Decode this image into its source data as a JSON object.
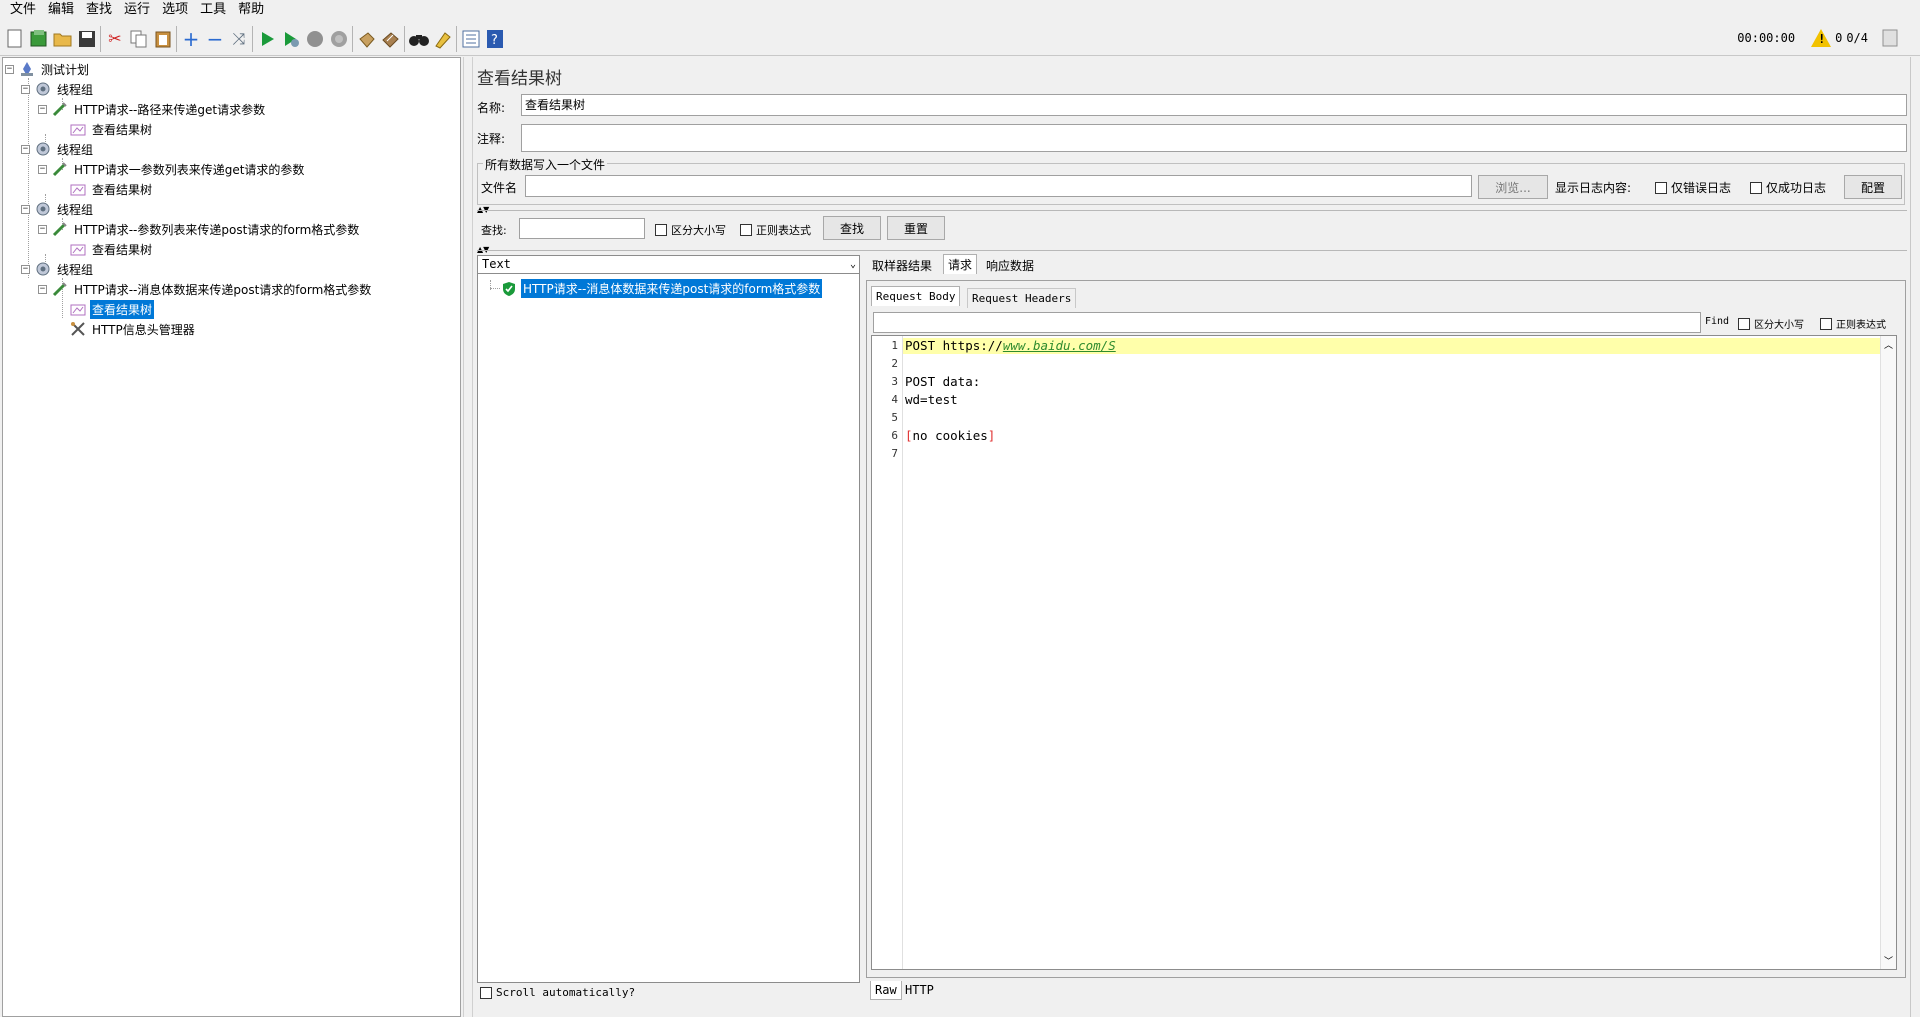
{
  "menu": [
    "文件",
    "编辑",
    "查找",
    "运行",
    "选项",
    "工具",
    "帮助"
  ],
  "toolbar": {
    "icons": [
      "new-icon",
      "templates-icon",
      "open-icon",
      "save-icon",
      "cut-icon",
      "copy-icon",
      "paste-icon",
      "expand-icon",
      "collapse-icon",
      "toggle-icon",
      "start-icon",
      "start-no-pause-icon",
      "stop-icon",
      "shutdown-icon",
      "clear-icon",
      "clear-all-icon",
      "search-icon",
      "reset-search-icon",
      "function-helper-icon",
      "help-icon"
    ],
    "timer": "00:00:00",
    "warning_count": "0",
    "threads": "0/4"
  },
  "tree": {
    "items": [
      {
        "label": "测试计划",
        "icon": "test-plan-icon",
        "level": 0
      },
      {
        "label": "线程组",
        "icon": "thread-group-icon",
        "level": 1
      },
      {
        "label": "HTTP请求--路径来传递get请求参数",
        "icon": "http-sampler-icon",
        "level": 2
      },
      {
        "label": "查看结果树",
        "icon": "listener-icon",
        "level": 3
      },
      {
        "label": "线程组",
        "icon": "thread-group-icon",
        "level": 1
      },
      {
        "label": "HTTP请求一参数列表来传递get请求的参数",
        "icon": "http-sampler-icon",
        "level": 2
      },
      {
        "label": "查看结果树",
        "icon": "listener-icon",
        "level": 3
      },
      {
        "label": "线程组",
        "icon": "thread-group-icon",
        "level": 1
      },
      {
        "label": "HTTP请求--参数列表来传递post请求的form格式参数",
        "icon": "http-sampler-icon",
        "level": 2
      },
      {
        "label": "查看结果树",
        "icon": "listener-icon",
        "level": 3
      },
      {
        "label": "线程组",
        "icon": "thread-group-icon",
        "level": 1
      },
      {
        "label": "HTTP请求--消息体数据来传递post请求的form格式参数",
        "icon": "http-sampler-icon",
        "level": 2
      },
      {
        "label": "查看结果树",
        "icon": "listener-icon",
        "level": 3,
        "selected": true
      },
      {
        "label": "HTTP信息头管理器",
        "icon": "header-manager-icon",
        "level": 3
      }
    ]
  },
  "panel": {
    "title": "查看结果树",
    "name_label": "名称:",
    "name_value": "查看结果树",
    "comment_label": "注释:",
    "comment_value": "",
    "file_group_title": "所有数据写入一个文件",
    "file_label": "文件名",
    "file_value": "",
    "browse_button": "浏览...",
    "log_content_label": "显示日志内容:",
    "errors_only": "仅错误日志",
    "success_only": "仅成功日志",
    "configure_button": "配置",
    "search_label": "查找:",
    "search_value": "",
    "case_sensitive": "区分大小写",
    "regex": "正则表达式",
    "find_button": "查找",
    "reset_button": "重置"
  },
  "results": {
    "renderer": "Text",
    "sample_label": "HTTP请求--消息体数据来传递post请求的form格式参数",
    "scroll_auto": "Scroll automatically?"
  },
  "detail": {
    "tabs": [
      "取样器结果",
      "请求",
      "响应数据"
    ],
    "active_tab": "请求",
    "subtabs": [
      "Request Body",
      "Request Headers"
    ],
    "find_label": "Find",
    "find_case": "区分大小写",
    "find_regex": "正则表达式",
    "lines": [
      "1",
      "2",
      "3",
      "4",
      "5",
      "6",
      "7"
    ],
    "code": {
      "l1_prefix": "POST https://",
      "l1_url": "www.baidu.com/S",
      "l3": "POST data:",
      "l4": "wd=test",
      "l6_open": "[",
      "l6_mid": "no cookies",
      "l6_close": "]"
    },
    "bottom_tabs": [
      "Raw",
      "HTTP"
    ]
  },
  "colors": {
    "selection": "#0078d7",
    "highlight_line": "#ffffaa",
    "link": "#2e8b2e",
    "bracket": "#e03030"
  }
}
